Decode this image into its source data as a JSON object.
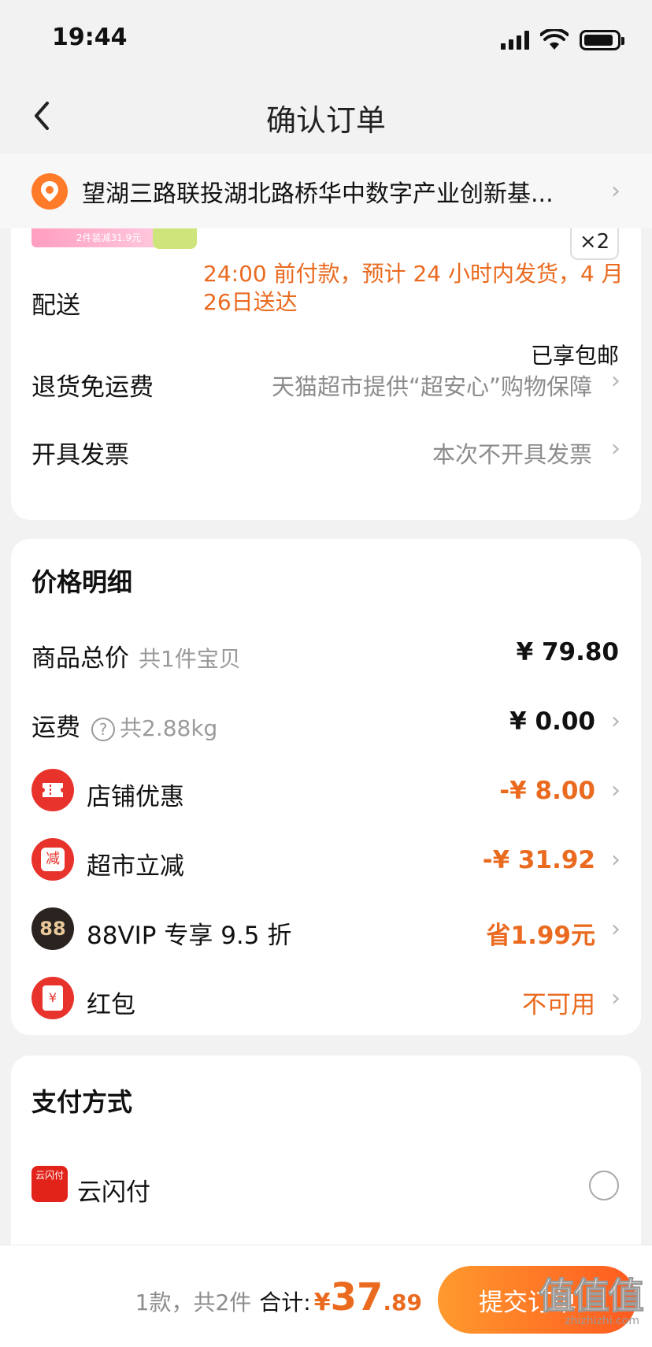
{
  "status_bar": {
    "time": "19:44"
  },
  "nav": {
    "title": "确认订单"
  },
  "address": {
    "text": "望湖三路联投湖北路桥华中数字产业创新基..."
  },
  "product": {
    "banner": "2件装减31.9元",
    "quantity": "×2"
  },
  "delivery": {
    "label": "配送",
    "note": "24:00 前付款，预计 24 小时内发货，4 月26日送达",
    "sub": "已享包邮"
  },
  "return_shipping": {
    "label": "退货免运费",
    "value": "天猫超市提供“超安心”购物保障"
  },
  "invoice": {
    "label": "开具发票",
    "value": "本次不开具发票"
  },
  "price_detail": {
    "title": "价格明细",
    "total": {
      "label": "商品总价",
      "sub": "共1件宝贝",
      "value": "¥ 79.80"
    },
    "shipping": {
      "label": "运费",
      "sub": "共2.88kg",
      "value": "¥ 0.00"
    },
    "store_discount": {
      "label": "店铺优惠",
      "value": "-¥ 8.00"
    },
    "market_discount": {
      "label": "超市立减",
      "icon_text": "减",
      "value": "-¥ 31.92"
    },
    "vip": {
      "label": "88VIP 专享 9.5 折",
      "icon_text": "88",
      "value": "省1.99元"
    },
    "red_packet": {
      "label": "红包",
      "icon_text": "¥",
      "value": "不可用"
    }
  },
  "payment": {
    "title": "支付方式",
    "method": {
      "label": "云闪付",
      "icon_text": "云闪付"
    }
  },
  "bottom": {
    "count": "1款，共2件",
    "total_label": "合计:",
    "currency": "¥",
    "amount_int": "37",
    "amount_dec": ".89",
    "submit": "提交订单",
    "watermark": "值值值",
    "watermark_url": "zhizhizhi.com"
  },
  "colors": {
    "accent": "#ea6a1f",
    "submit_start": "#ff9a2e",
    "submit_end": "#ff5a1f",
    "red_icon": "#e8332c"
  }
}
